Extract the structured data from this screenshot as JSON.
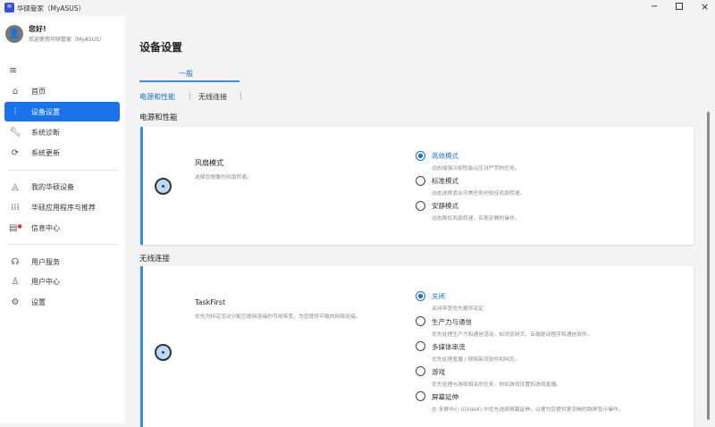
{
  "window": {
    "title": "华硕管家（MyASUS）",
    "logo": "MY"
  },
  "user": {
    "greeting": "您好!",
    "welcome": "欢迎使用华硕管家（MyASUS）"
  },
  "sidebar": {
    "items": [
      {
        "label": "首页",
        "icon": "home-icon"
      },
      {
        "label": "设备设置",
        "icon": "sliders-icon"
      },
      {
        "label": "系统诊断",
        "icon": "wrench-icon"
      },
      {
        "label": "系统更新",
        "icon": "update-icon"
      },
      {
        "label": "我的华硕设备",
        "icon": "device-icon"
      },
      {
        "label": "华硕应用程序与推荐",
        "icon": "apps-grid-icon"
      },
      {
        "label": "信息中心",
        "icon": "message-icon"
      },
      {
        "label": "用户服务",
        "icon": "headset-icon"
      },
      {
        "label": "用户中心",
        "icon": "user-icon"
      },
      {
        "label": "设置",
        "icon": "gear-icon"
      }
    ]
  },
  "main": {
    "title": "设备设置",
    "tab": "一般",
    "subtabs": [
      "电源和性能",
      "无线连接"
    ],
    "sections": [
      {
        "heading": "电源和性能",
        "card": {
          "title": "风扇模式",
          "desc": "选择您想要的风扇转速。",
          "options": [
            {
              "label": "高效模式",
              "desc": "动态增强冷却性能以应对严苛的任务。",
              "selected": true
            },
            {
              "label": "标准模式",
              "desc": "动态选择适合日常任务的较佳风扇转速。",
              "selected": false
            },
            {
              "label": "安静模式",
              "desc": "动态降低风扇转速，实现安静的操作。",
              "selected": false
            }
          ]
        }
      },
      {
        "heading": "无线连接",
        "card": {
          "title": "TaskFirst",
          "desc": "优先为特定活动分配互联网连接的可用带宽，为您提供平稳的网络连接。",
          "options": [
            {
              "label": "关闭",
              "desc": "关闭带宽优先顺序设定",
              "selected": true
            },
            {
              "label": "生产力与通信",
              "desc": "优先处理生产力和通信活动，如浏览网页、云端驱动程序和通信软件。",
              "selected": false
            },
            {
              "label": "多媒体串流",
              "desc": "优先处理直播 / 视频串流软件和网页。",
              "selected": false
            },
            {
              "label": "游戏",
              "desc": "优先处理与游戏相关的任务，例如游戏设置和游戏直播。",
              "selected": false
            },
            {
              "label": "屏幕延伸",
              "desc": "在 多屏中心 (GlideX) 中优先选择屏幕延伸，以便为您提供更流畅的跨屏显示操作。",
              "selected": false
            }
          ]
        }
      }
    ]
  },
  "colors": {
    "accent": "#1a73e8",
    "card_border": "#3a8fe0"
  }
}
